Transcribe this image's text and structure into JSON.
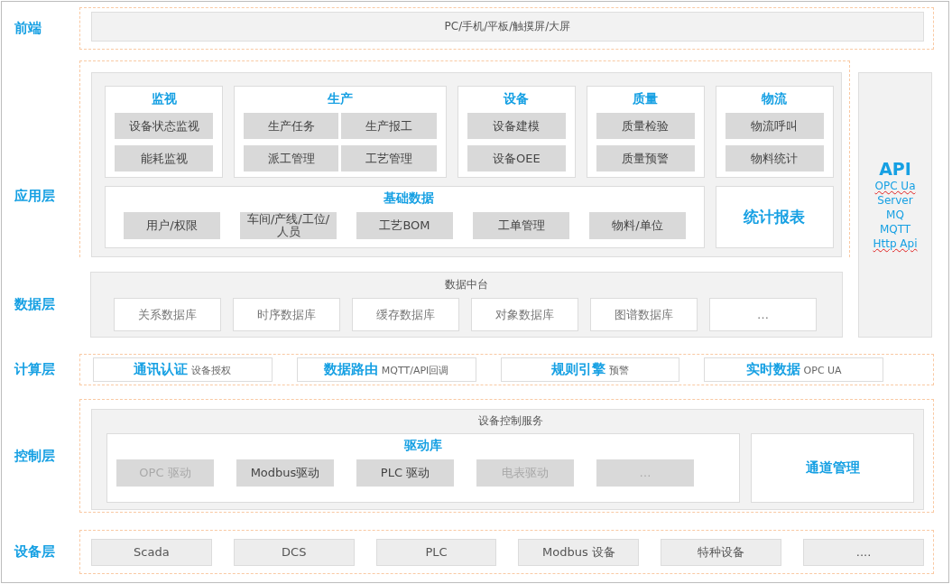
{
  "frontend": {
    "label": "前端",
    "bar": "PC/手机/平板/触摸屏/大屏"
  },
  "application": {
    "label": "应用层",
    "modules": [
      {
        "title": "监视",
        "items": [
          "设备状态监视",
          "能耗监视"
        ]
      },
      {
        "title": "生产",
        "items": [
          "生产任务",
          "生产报工",
          "派工管理",
          "工艺管理"
        ]
      },
      {
        "title": "设备",
        "items": [
          "设备建模",
          "设备OEE"
        ]
      },
      {
        "title": "质量",
        "items": [
          "质量检验",
          "质量预警"
        ]
      },
      {
        "title": "物流",
        "items": [
          "物流呼叫",
          "物料统计"
        ]
      }
    ],
    "base_data": {
      "title": "基础数据",
      "items": [
        "用户/权限",
        "车间/产线/工位/人员",
        "工艺BOM",
        "工单管理",
        "物料/单位"
      ]
    },
    "reports": "统计报表"
  },
  "api": {
    "title": "API",
    "protocols": [
      {
        "text": "OPC Ua",
        "misspelled": true
      },
      {
        "text": "Server",
        "misspelled": false
      },
      {
        "text": "MQ",
        "misspelled": false
      },
      {
        "text": "MQTT",
        "misspelled": false
      },
      {
        "text": "Http Api",
        "misspelled": true
      }
    ]
  },
  "data": {
    "label": "数据层",
    "title": "数据中台",
    "items": [
      "关系数据库",
      "时序数据库",
      "缓存数据库",
      "对象数据库",
      "图谱数据库",
      "…"
    ]
  },
  "compute": {
    "label": "计算层",
    "items": [
      {
        "title": "通讯认证",
        "note": "设备授权"
      },
      {
        "title": "数据路由",
        "note": "MQTT/API回调"
      },
      {
        "title": "规则引擎",
        "note": "预警"
      },
      {
        "title": "实时数据",
        "note": "OPC UA"
      }
    ]
  },
  "control": {
    "label": "控制层",
    "title": "设备控制服务",
    "drivers": {
      "title": "驱动库",
      "items": [
        {
          "text": "OPC 驱动",
          "disabled": true
        },
        {
          "text": "Modbus驱动",
          "disabled": false
        },
        {
          "text": "PLC 驱动",
          "disabled": false
        },
        {
          "text": "电表驱动",
          "disabled": true
        },
        {
          "text": "…",
          "disabled": true
        }
      ]
    },
    "channel": "通道管理"
  },
  "device": {
    "label": "设备层",
    "items": [
      "Scada",
      "DCS",
      "PLC",
      "Modbus 设备",
      "特种设备",
      "...."
    ]
  }
}
